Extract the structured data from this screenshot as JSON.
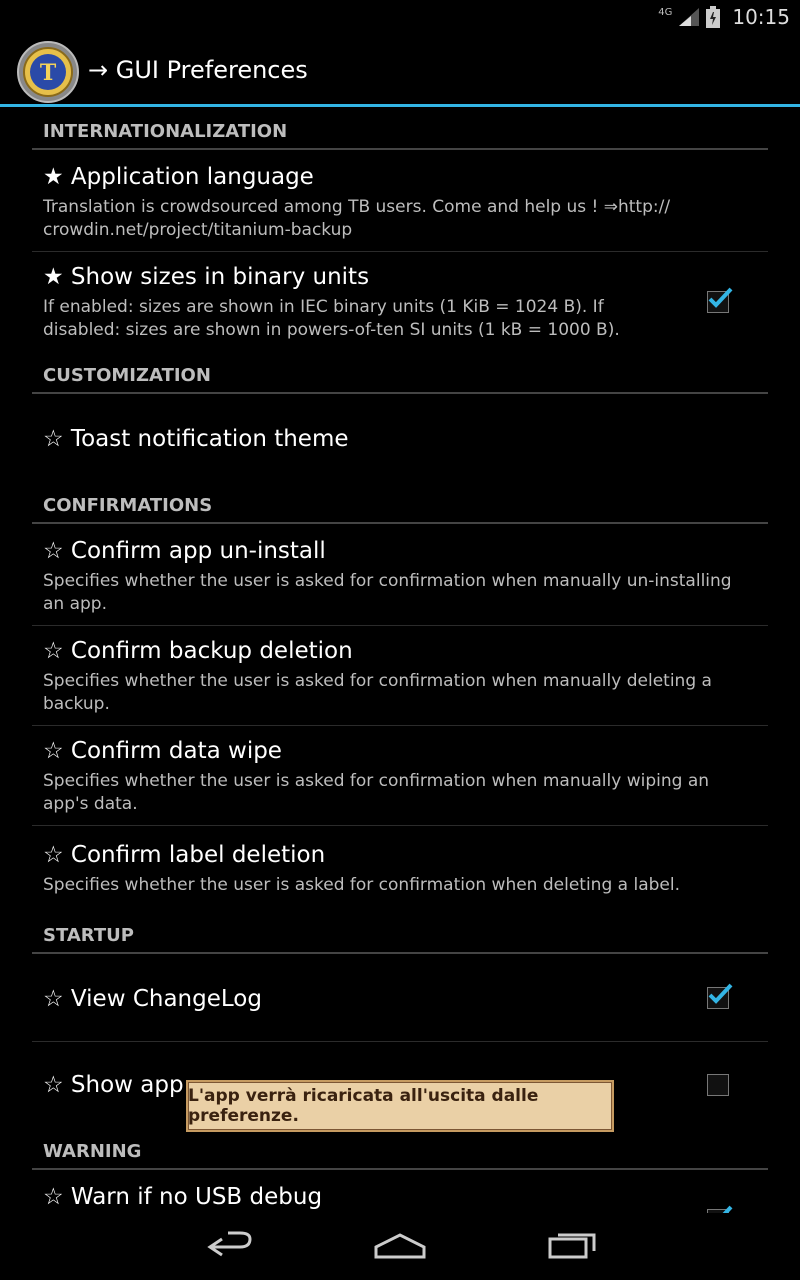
{
  "status": {
    "network": "4G",
    "time": "10:15"
  },
  "actionbar": {
    "title": "→ GUI Preferences",
    "app_icon": "titanium-backup-icon"
  },
  "sections": {
    "internationalization": "INTERNATIONALIZATION",
    "customization": "CUSTOMIZATION",
    "confirmations": "CONFIRMATIONS",
    "startup": "STARTUP",
    "warning": "WARNING"
  },
  "items": {
    "app_language": {
      "title": "★ Application language",
      "summary": "Translation is crowdsourced among TB users. Come and help us ! ⇒http:// crowdin.net/project/titanium-backup"
    },
    "binary_units": {
      "title": "★ Show sizes in binary units",
      "summary": "If enabled: sizes are shown in IEC binary units (1 KiB = 1024 B). If disabled: sizes are shown in powers-of-ten SI units (1 kB = 1000 B).",
      "checked": true
    },
    "toast_theme": {
      "title": "☆ Toast notification theme"
    },
    "confirm_uninstall": {
      "title": "☆ Confirm app un-install",
      "summary": "Specifies whether the user is asked for confirmation when manually un-installing an app."
    },
    "confirm_backup_deletion": {
      "title": "☆ Confirm backup deletion",
      "summary": "Specifies whether the user is asked for confirmation when manually deleting a backup."
    },
    "confirm_data_wipe": {
      "title": "☆ Confirm data wipe",
      "summary": "Specifies whether the user is asked for confirmation when manually wiping an app's data."
    },
    "confirm_label_deletion": {
      "title": "☆ Confirm label deletion",
      "summary": "Specifies whether the user is asked for confirmation when deleting a label."
    },
    "view_changelog": {
      "title": "☆ View ChangeLog",
      "checked": true
    },
    "show_app_list": {
      "title": "☆ Show app",
      "checked": false
    },
    "warn_usb_debug": {
      "title": "☆ Warn if no USB debug",
      "checked": true
    }
  },
  "toast": {
    "message": "L'app verrà ricaricata all'uscita dalle preferenze."
  },
  "navbar": {
    "back": "back-icon",
    "home": "home-icon",
    "recents": "recents-icon"
  },
  "colors": {
    "accent": "#33b5e5",
    "check": "#33b5e5",
    "toast_bg": "#ead0a6"
  }
}
